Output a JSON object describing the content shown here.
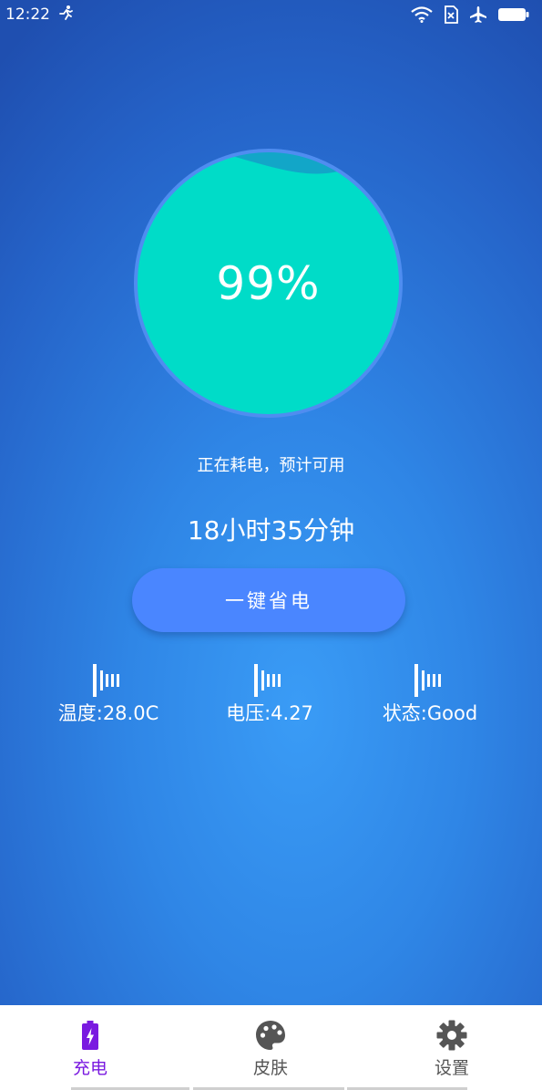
{
  "status_bar": {
    "time": "12:22",
    "icons": [
      "running-icon",
      "wifi-icon",
      "no-sim-icon",
      "airplane-icon",
      "battery-icon"
    ]
  },
  "gauge": {
    "percent_text": "99%",
    "level": 0.99,
    "fill_color": "#00dcc8",
    "ring_color": "#4f8df0"
  },
  "status_text": "正在耗电，预计可用",
  "remaining_time": "18小时35分钟",
  "save_button_label": "一键省电",
  "stats": [
    {
      "label": "温度:28.0C",
      "icon": "bars-icon"
    },
    {
      "label": "电压:4.27",
      "icon": "bars-icon"
    },
    {
      "label": "状态:Good",
      "icon": "bars-icon"
    }
  ],
  "nav": [
    {
      "label": "充电",
      "icon": "battery-charging-icon",
      "active": true
    },
    {
      "label": "皮肤",
      "icon": "palette-icon",
      "active": false
    },
    {
      "label": "设置",
      "icon": "gear-icon",
      "active": false
    }
  ],
  "colors": {
    "accent": "#7a1ae0",
    "button": "#4a86ff",
    "nav_icon": "#555555"
  }
}
